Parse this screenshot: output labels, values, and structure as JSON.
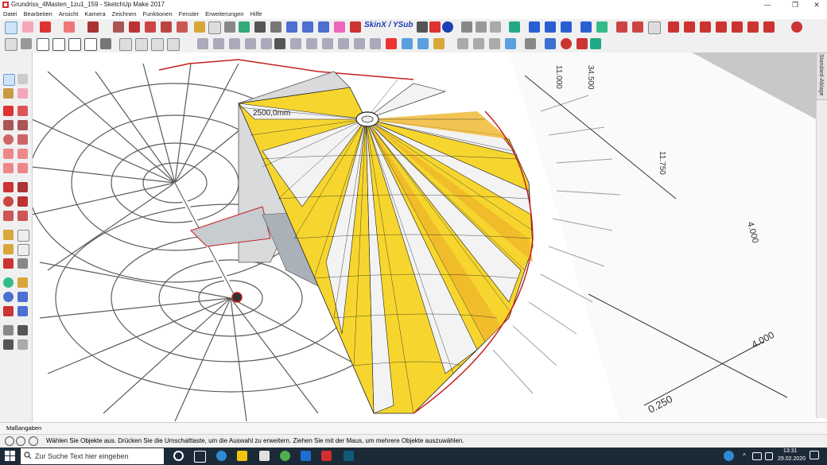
{
  "window": {
    "title": "Grundriss_4Masten_1zu1_159 - SketchUp Make 2017",
    "minimize": "—",
    "maximize": "❐",
    "close": "✕"
  },
  "menu": [
    {
      "label": "Datei"
    },
    {
      "label": "Bearbeiten"
    },
    {
      "label": "Ansicht"
    },
    {
      "label": "Kamera"
    },
    {
      "label": "Zeichnen"
    },
    {
      "label": "Funktionen"
    },
    {
      "label": "Fenster"
    },
    {
      "label": "Erweiterungen"
    },
    {
      "label": "Hilfe"
    }
  ],
  "toolbar": {
    "skin_label": "SkinX / YSub",
    "accent": "#1b3fb5"
  },
  "tray": {
    "label": "Standard-Ablage"
  },
  "viewport": {
    "dimension_label": "2500,0mm",
    "ground_labels": [
      "4.000",
      "11.750",
      "34.500",
      "11.000",
      "4.000",
      "0.250"
    ],
    "tent_colors": {
      "yellow": "#f6d62e",
      "orange": "#f0b62a",
      "white": "#f3f3f3",
      "outline": "#c81e1e"
    }
  },
  "measure": {
    "label": "Maßangaben"
  },
  "status": {
    "text": "Wählen Sie Objekte aus. Drücken Sie die Umschalttaste, um die Auswahl zu erweitern. Ziehen Sie mit der Maus, um mehrere Objekte auszuwählen."
  },
  "taskbar": {
    "search_placeholder": "Zur Suche Text hier eingeben",
    "time": "13:31",
    "date": "29.02.2020"
  }
}
